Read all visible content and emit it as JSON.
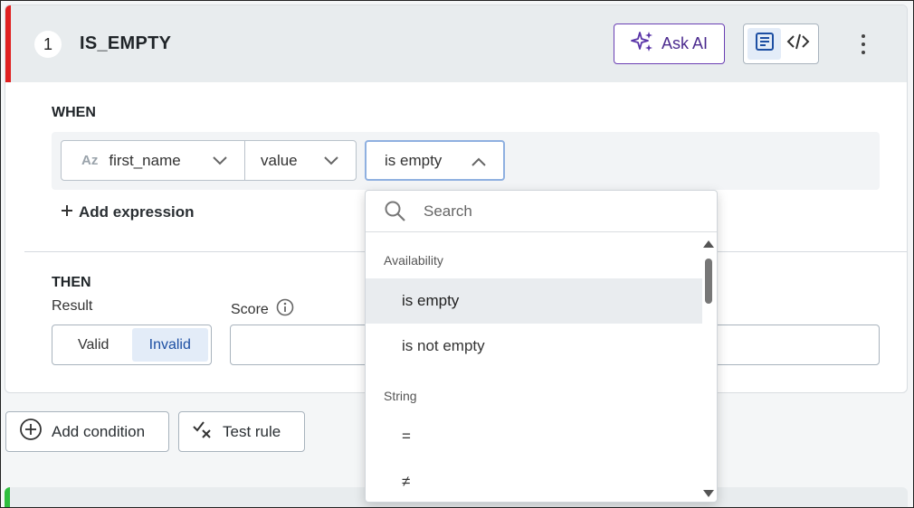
{
  "rule": {
    "number": "1",
    "title": "IS_EMPTY",
    "accent_color": "#e02020",
    "ask_ai_label": "Ask AI",
    "view_modes": [
      "form-view-icon",
      "code-view-icon"
    ],
    "active_view": "form"
  },
  "when": {
    "label": "WHEN",
    "field_type": "Az",
    "field_name": "first_name",
    "field_property": "value",
    "operator": "is empty",
    "add_expression_label": "Add expression"
  },
  "then": {
    "label": "THEN",
    "result_label": "Result",
    "score_label": "Score",
    "result_options": [
      "Valid",
      "Invalid"
    ],
    "selected_result": "Invalid",
    "score_value": ""
  },
  "actions": {
    "add_condition_label": "Add condition",
    "test_rule_label": "Test rule"
  },
  "dropdown": {
    "search_placeholder": "Search",
    "groups": [
      {
        "name": "Availability",
        "items": [
          "is empty",
          "is not empty"
        ]
      },
      {
        "name": "String",
        "items": [
          "=",
          "≠"
        ]
      }
    ],
    "selected": "is empty"
  },
  "next_rule": {
    "accent_color": "#2fbf3f"
  }
}
